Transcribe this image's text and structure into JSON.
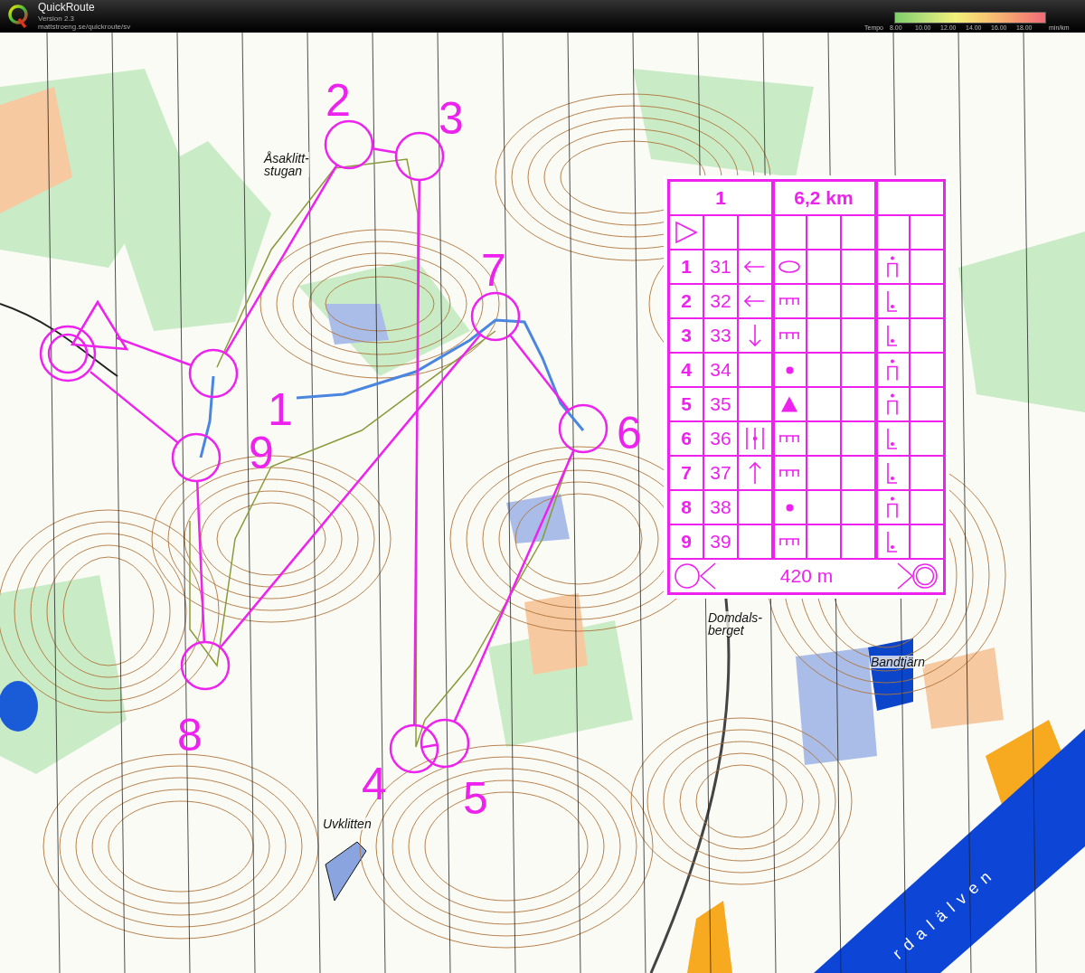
{
  "app": {
    "name": "QuickRoute",
    "version": "Version 2.3",
    "url": "mattstroeng.se/quickroute/sv"
  },
  "tempo_legend": {
    "label": "Tempo",
    "ticks": [
      "8.00",
      "10.00",
      "12.00",
      "14.00",
      "16.00",
      "18.00"
    ],
    "unit": "min/km"
  },
  "map": {
    "place_names": [
      {
        "kind": "stacked",
        "lines": [
          "Åsaklitt-",
          "stugan"
        ]
      },
      {
        "kind": "stacked",
        "lines": [
          "Domdals-",
          "berget"
        ]
      },
      {
        "kind": "plain",
        "lines": [
          "Bandtjärn"
        ]
      },
      {
        "kind": "plain",
        "lines": [
          "Uvklitten"
        ]
      },
      {
        "kind": "spaced",
        "lines": [
          "rdalälven"
        ]
      }
    ]
  },
  "course": {
    "controls": [
      {
        "number": "1"
      },
      {
        "number": "2"
      },
      {
        "number": "3"
      },
      {
        "number": "4"
      },
      {
        "number": "5"
      },
      {
        "number": "6"
      },
      {
        "number": "7"
      },
      {
        "number": "8"
      },
      {
        "number": "9"
      }
    ]
  },
  "description_sheet": {
    "class": "1",
    "length": "6,2 km",
    "rows": [
      {
        "number": "1",
        "code": "31",
        "direction_symbol": {
          "kind": "left"
        },
        "feature_symbol": {
          "kind": "ellipse"
        },
        "position_symbol": {
          "kind": "top"
        }
      },
      {
        "number": "2",
        "code": "32",
        "direction_symbol": {
          "kind": "left"
        },
        "feature_symbol": {
          "kind": "comb"
        },
        "position_symbol": {
          "kind": "foot"
        }
      },
      {
        "number": "3",
        "code": "33",
        "direction_symbol": {
          "kind": "down"
        },
        "feature_symbol": {
          "kind": "comb"
        },
        "position_symbol": {
          "kind": "foot"
        }
      },
      {
        "number": "4",
        "code": "34",
        "feature_symbol": {
          "kind": "dot"
        },
        "position_symbol": {
          "kind": "top"
        }
      },
      {
        "number": "5",
        "code": "35",
        "feature_symbol": {
          "kind": "triangle"
        },
        "position_symbol": {
          "kind": "top"
        }
      },
      {
        "number": "6",
        "code": "36",
        "direction_symbol": {
          "kind": "between"
        },
        "feature_symbol": {
          "kind": "comb"
        },
        "position_symbol": {
          "kind": "foot"
        }
      },
      {
        "number": "7",
        "code": "37",
        "direction_symbol": {
          "kind": "up"
        },
        "feature_symbol": {
          "kind": "comb"
        },
        "position_symbol": {
          "kind": "foot"
        }
      },
      {
        "number": "8",
        "code": "38",
        "feature_symbol": {
          "kind": "dot"
        },
        "position_symbol": {
          "kind": "top"
        }
      },
      {
        "number": "9",
        "code": "39",
        "feature_symbol": {
          "kind": "comb"
        },
        "position_symbol": {
          "kind": "foot"
        }
      }
    ],
    "finish_distance": "420 m"
  }
}
